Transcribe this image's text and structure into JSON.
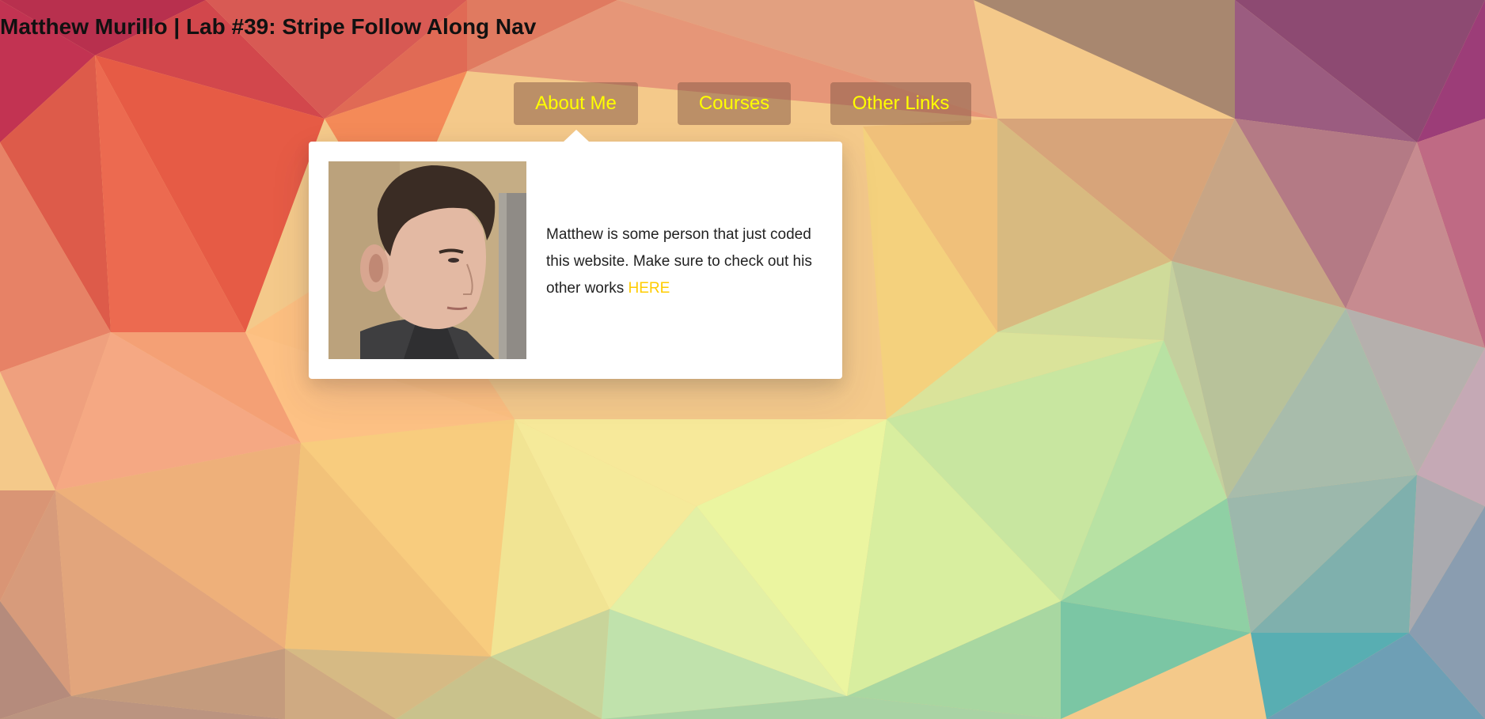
{
  "page": {
    "title": "Matthew Murillo | Lab #39: Stripe Follow Along Nav"
  },
  "nav": {
    "items": [
      {
        "label": "About Me",
        "active": true
      },
      {
        "label": "Courses",
        "active": false
      },
      {
        "label": "Other Links",
        "active": false
      }
    ]
  },
  "dropdown": {
    "bio_text": "Matthew is some person that just coded this website. Make sure to check out his other works ",
    "link_label": "HERE",
    "photo_icon": "profile-photo"
  },
  "colors": {
    "nav_text": "#ffff00",
    "link": "#ffcc00",
    "nav_bg": "rgba(140, 95, 75, 0.55)"
  }
}
